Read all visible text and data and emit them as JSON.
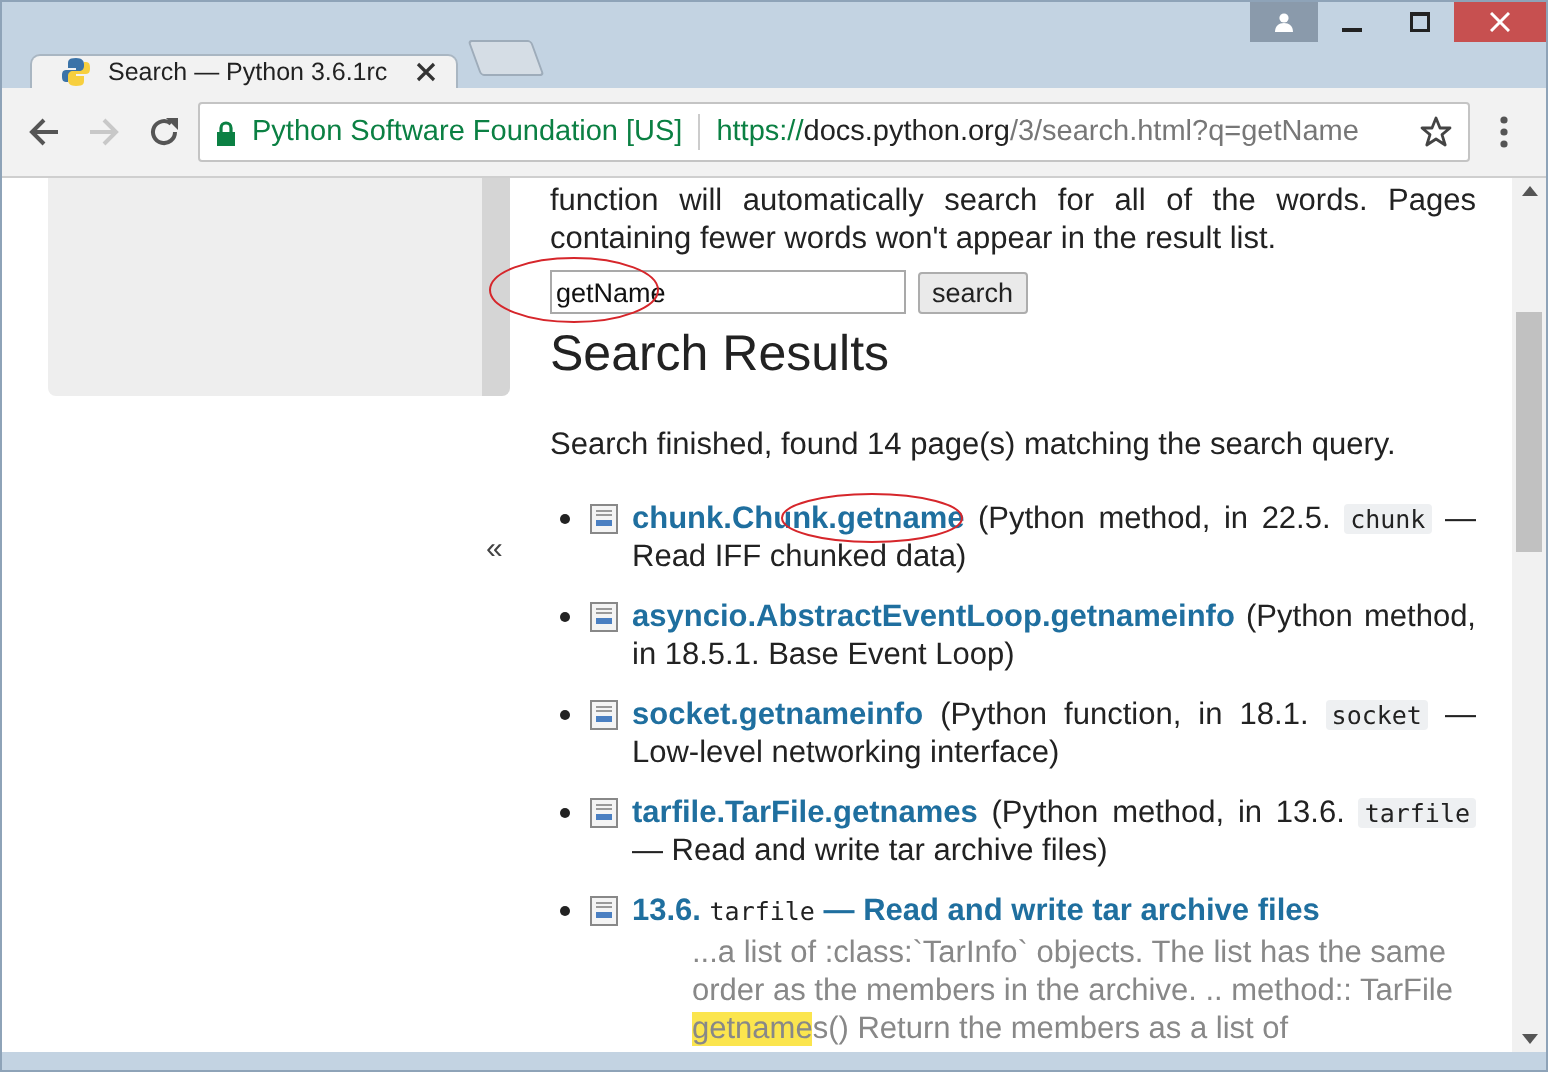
{
  "window": {
    "tab_title": "Search — Python 3.6.1rc"
  },
  "address_bar": {
    "site_identity": "Python Software Foundation [US]",
    "url_scheme": "https://",
    "url_host": "docs.python.org",
    "url_path": "/3/search.html?q=getName"
  },
  "sidebar": {
    "collapse_label": "«"
  },
  "intro": "function will automatically search for all of the words. Pages containing fewer words won't appear in the result list.",
  "search_form": {
    "value": "getName",
    "button": "search"
  },
  "heading": "Search Results",
  "summary": "Search finished, found 14 page(s) matching the search query.",
  "results": [
    {
      "parts": [
        {
          "kind": "link",
          "text": "chunk.Chunk.getname"
        },
        {
          "kind": "plain",
          "text": " (Python method, in 22.5. "
        },
        {
          "kind": "code",
          "text": "chunk"
        },
        {
          "kind": "plain",
          "text": " — Read IFF chunked data)"
        }
      ]
    },
    {
      "parts": [
        {
          "kind": "link",
          "text": "asyncio.AbstractEventLoop.getnameinfo"
        },
        {
          "kind": "plain",
          "text": " (Python method, in 18.5.1. Base Event Loop)"
        }
      ]
    },
    {
      "parts": [
        {
          "kind": "link",
          "text": "socket.getnameinfo"
        },
        {
          "kind": "plain",
          "text": " (Python function, in 18.1. "
        },
        {
          "kind": "code",
          "text": "socket"
        },
        {
          "kind": "plain",
          "text": " — Low-level networking interface)"
        }
      ]
    },
    {
      "parts": [
        {
          "kind": "link",
          "text": "tarfile.TarFile.getnames"
        },
        {
          "kind": "plain",
          "text": " (Python method, in 13.6. "
        },
        {
          "kind": "code",
          "text": "tarfile"
        },
        {
          "kind": "plain",
          "text": " — Read and write tar archive files)"
        }
      ]
    },
    {
      "parts": [
        {
          "kind": "link",
          "text": "13.6. "
        },
        {
          "kind": "link_code",
          "text": "tarfile"
        },
        {
          "kind": "link",
          "text": " — Read and write tar archive files"
        }
      ],
      "excerpt": [
        {
          "kind": "plain",
          "text": "...a list of :class:`TarInfo` objects. The list has the same order as the members in the archive. .. method:: TarFile "
        },
        {
          "kind": "highlight",
          "text": "getname"
        },
        {
          "kind": "plain",
          "text": "s() Return the members as a list of"
        }
      ]
    }
  ]
}
